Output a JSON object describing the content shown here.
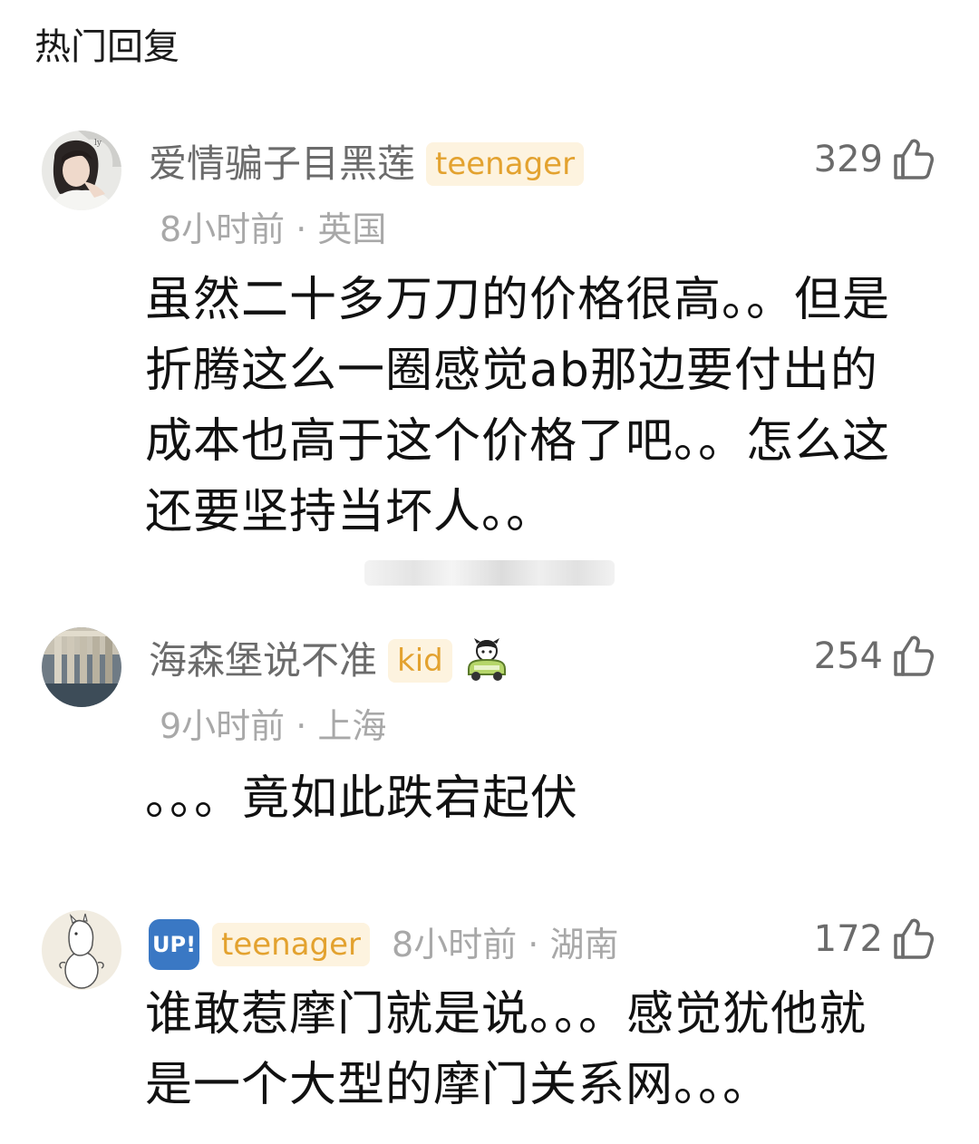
{
  "section": {
    "title": "热门回复"
  },
  "comments": [
    {
      "username": "爱情骗子目黑莲",
      "badge": "teenager",
      "meta": "8小时前 · 英国",
      "likes": "329",
      "text": "虽然二十多万刀的价格很高。。但是折腾这么一圈感觉ab那边要付出的成本也高于这个价格了吧。。怎么这还要坚持当坏人。。",
      "avatar_icon": "portrait-avatar"
    },
    {
      "username": "海森堡说不准",
      "badge": "kid",
      "meta": "9小时前 · 上海",
      "likes": "254",
      "text": "。。。竟如此跌宕起伏",
      "avatar_icon": "building-avatar",
      "sticker_icon": "car-sticker-icon"
    },
    {
      "up_badge": "UP!",
      "badge": "teenager",
      "meta": "8小时前 · 湖南",
      "likes": "172",
      "text": "谁敢惹摩门就是说。。。感觉犹他就是一个大型的摩门关系网。。。",
      "avatar_icon": "moomin-avatar"
    }
  ],
  "colors": {
    "badge_text": "#e3a22f",
    "badge_bg": "#fdf3df",
    "up_badge_bg": "#3a78c4",
    "meta_text": "#a8a8a8",
    "username_text": "#6b6b6b"
  }
}
